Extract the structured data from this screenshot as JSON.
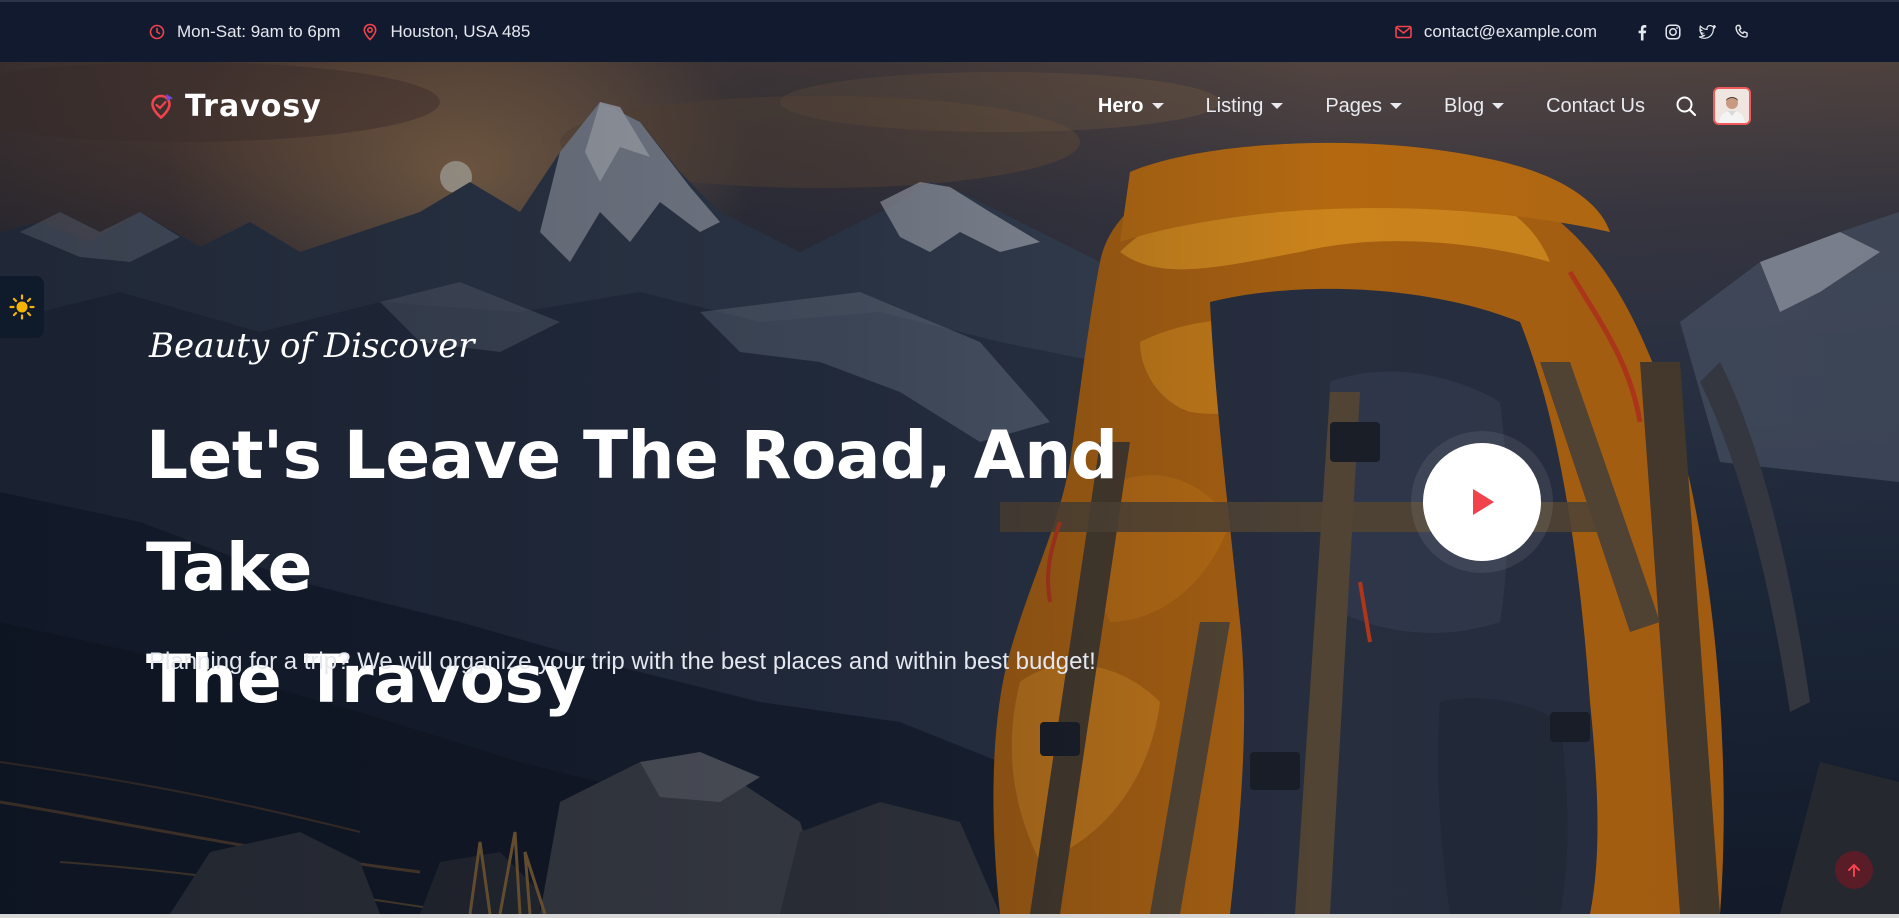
{
  "topbar": {
    "hours": "Mon-Sat: 9am to 6pm",
    "location": "Houston, USA 485",
    "email": "contact@example.com",
    "socials": [
      "facebook-icon",
      "instagram-icon",
      "twitter-icon",
      "phone-icon"
    ]
  },
  "brand": {
    "name": "Travosy",
    "accent": "#f0434b"
  },
  "nav": {
    "items": [
      {
        "label": "Hero",
        "dropdown": true,
        "active": true
      },
      {
        "label": "Listing",
        "dropdown": true,
        "active": false
      },
      {
        "label": "Pages",
        "dropdown": true,
        "active": false
      },
      {
        "label": "Blog",
        "dropdown": true,
        "active": false
      },
      {
        "label": "Contact Us",
        "dropdown": false,
        "active": false
      }
    ]
  },
  "hero": {
    "tagline": "Beauty of Discover",
    "title_line1": "Let's Leave The Road, And Take",
    "title_line2": "The Travosy",
    "subtitle": "Planning for a trip? We will organize your trip with the best places and within best budget!"
  },
  "colors": {
    "accent": "#f0434b",
    "topbar_bg": "#111a2e",
    "toggle_sun": "#f5b400"
  }
}
